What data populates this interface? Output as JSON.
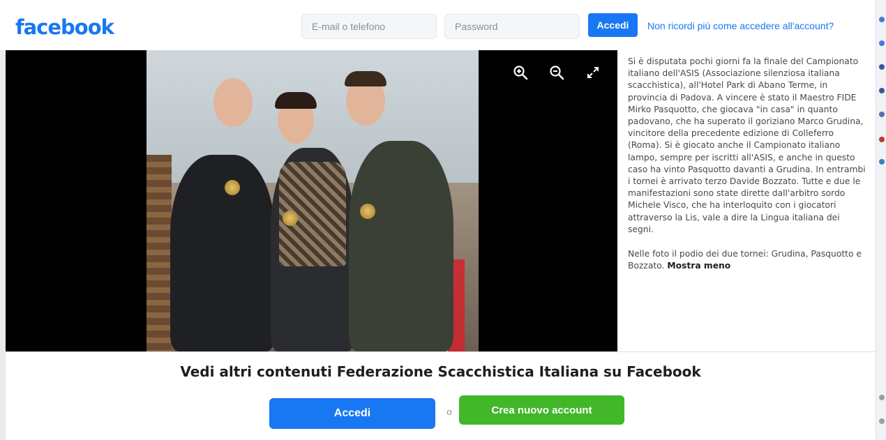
{
  "header": {
    "logo": "facebook",
    "email_placeholder": "E-mail o telefono",
    "password_placeholder": "Password",
    "login_label": "Accedi",
    "forgot_link": "Non ricordi più come accedere all'account?"
  },
  "viewer": {
    "controls": [
      "zoom-in-icon",
      "zoom-out-icon",
      "fullscreen-icon"
    ]
  },
  "caption": {
    "paragraph1": "Si è disputata pochi giorni fa la finale del Campionato italiano dell'ASIS (Associazione silenziosa italiana scacchistica), all'Hotel Park di Abano Terme, in provincia di Padova. A vincere è stato il Maestro FIDE Mirko Pasquotto, che giocava \"in casa\" in quanto padovano, che ha superato il goriziano Marco Grudina, vincitore della precedente edizione di Colleferro (Roma). Si è giocato anche il Campionato italiano lampo, sempre per iscritti all'ASIS, e anche in questo caso ha vinto Pasquotto davanti a Grudina. In entrambi i tornei è arrivato terzo Davide Bozzato. Tutte e due le manifestazioni sono state dirette dall'arbitro sordo Michele Visco, che ha interloquito con i giocatori attraverso la Lis, vale a dire la Lingua italiana dei segni.",
    "paragraph2": "Nelle foto il podio dei due tornei: Grudina, Pasquotto e Bozzato.",
    "show_less": "Mostra meno"
  },
  "banner": {
    "title": "Vedi altri contenuti Federazione Scacchistica Italiana su Facebook",
    "login_label": "Accedi",
    "or_label": "o",
    "create_label": "Crea nuovo account"
  },
  "colors": {
    "brand_blue": "#1877f2",
    "create_green": "#42b72a"
  }
}
